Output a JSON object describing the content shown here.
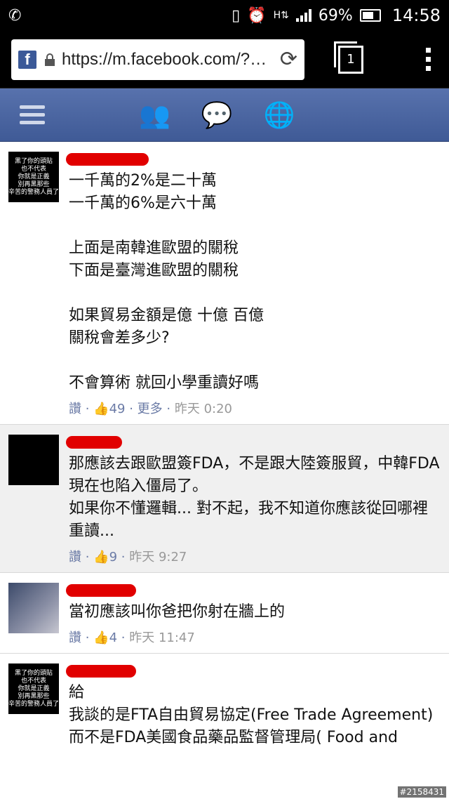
{
  "status_bar": {
    "battery": "69%",
    "time": "14:58",
    "icons": [
      "whatsapp-icon",
      "vibrate-icon",
      "alarm-icon",
      "hspa-icon",
      "signal-icon",
      "battery-icon"
    ]
  },
  "browser": {
    "url": "https://m.facebook.com/?…",
    "tab_count": "1"
  },
  "fb_nav": {
    "icons": [
      "menu-icon",
      "friends-icon",
      "messages-icon",
      "notifications-globe-icon"
    ]
  },
  "comments": [
    {
      "avatar_text": [
        "黑了你的頭貼",
        "也不代表",
        "你就是正義",
        "別再黑那些",
        "辛苦的警務人員了"
      ],
      "text": "一千萬的2%是二十萬\n一千萬的6%是六十萬\n\n上面是南韓進歐盟的關稅\n下面是臺灣進歐盟的關稅\n\n如果貿易金額是億 十億 百億\n關稅會差多少?\n\n不會算術 就回小學重讀好嗎",
      "like_label": "讚",
      "like_count": "49",
      "more_label": "更多",
      "date": "昨天 0:20"
    },
    {
      "text": "那應該去跟歐盟簽FDA，不是跟大陸簽服貿，中韓FDA現在也陷入僵局了。\n如果你不懂邏輯... 對不起，我不知道你應該從回哪裡重讀...",
      "like_label": "讚",
      "like_count": "9",
      "date": "昨天 9:27"
    },
    {
      "text": "當初應該叫你爸把你射在牆上的",
      "like_label": "讚",
      "like_count": "4",
      "date": "昨天 11:47"
    },
    {
      "avatar_text": [
        "黑了你的頭貼",
        "也不代表",
        "你就是正義",
        "別再黑那些",
        "辛苦的警務人員了"
      ],
      "text": "給\n我談的是FTA自由貿易協定(Free Trade Agreement)\n而不是FDA美國食品藥品監督管理局( Food and"
    }
  ],
  "watermark": "#2158431"
}
